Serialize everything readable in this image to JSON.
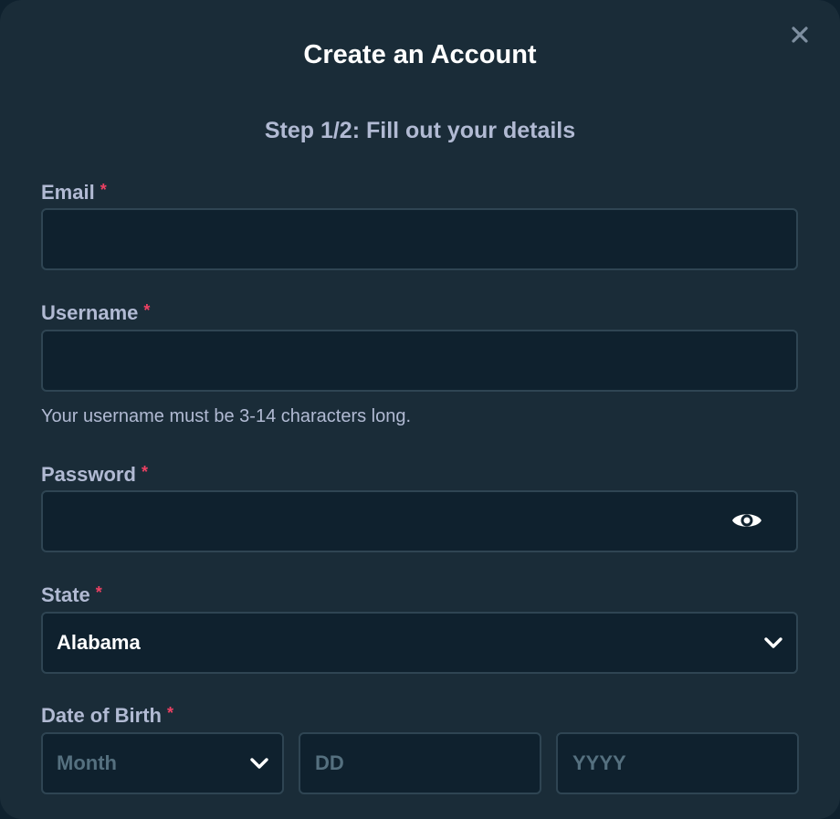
{
  "modal": {
    "title": "Create an Account",
    "subtitle": "Step 1/2: Fill out your details",
    "close_icon": "close-icon"
  },
  "fields": {
    "email": {
      "label": "Email",
      "required_mark": "*",
      "value": "",
      "placeholder": ""
    },
    "username": {
      "label": "Username",
      "required_mark": "*",
      "value": "",
      "placeholder": "",
      "helper": "Your username must be 3-14 characters long."
    },
    "password": {
      "label": "Password",
      "required_mark": "*",
      "value": "",
      "placeholder": "",
      "toggle_icon": "eye-icon"
    },
    "state": {
      "label": "State",
      "required_mark": "*",
      "selected": "Alabama",
      "icon": "chevron-down-icon"
    },
    "dob": {
      "label": "Date of Birth",
      "required_mark": "*",
      "month_placeholder": "Month",
      "day_placeholder": "DD",
      "year_placeholder": "YYYY"
    }
  },
  "colors": {
    "background": "#1a2c38",
    "input_background": "#0f212e",
    "input_border": "#2f4553",
    "label_text": "#b1bad3",
    "required": "#ed4163",
    "placeholder": "#55707f"
  }
}
